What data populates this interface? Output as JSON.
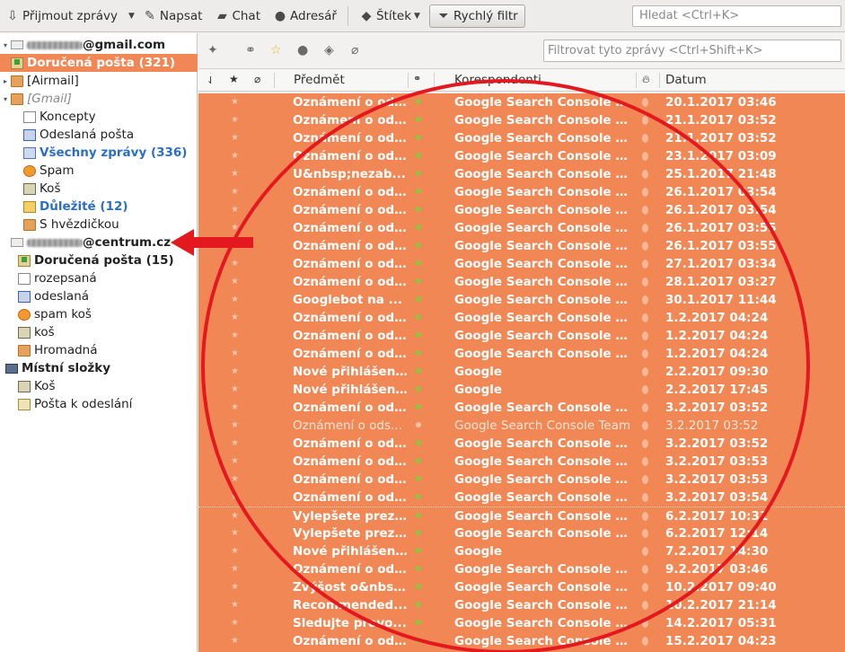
{
  "toolbar": {
    "get_messages": "Přijmout zprávy",
    "write": "Napsat",
    "chat": "Chat",
    "address_book": "Adresář",
    "tag": "Štítek",
    "quick_filter": "Rychlý filtr",
    "search_placeholder": "Hledat <Ctrl+K>"
  },
  "folders": {
    "gmail_account": "@gmail.com",
    "gmail_inbox": "Doručená pošta (321)",
    "airmail": "[Airmail]",
    "gmail_group": "[Gmail]",
    "drafts": "Koncepty",
    "sent": "Odeslaná pošta",
    "all_mail": "Všechny zprávy (336)",
    "spam": "Spam",
    "trash": "Koš",
    "important": "Důležité (12)",
    "starred": "S hvězdičkou",
    "centrum_account": "@centrum.cz",
    "centrum_inbox": "Doručená pošta (15)",
    "centrum_drafts": "rozepsaná",
    "centrum_sent": "odeslaná",
    "centrum_spam": "spam koš",
    "centrum_trash": "koš",
    "centrum_bulk": "Hromadná",
    "local_folders": "Místní složky",
    "local_trash": "Koš",
    "local_outbox": "Pošta k odeslání"
  },
  "filter_bar": {
    "placeholder": "Filtrovat tyto zprávy <Ctrl+Shift+K>"
  },
  "columns": {
    "subject": "Předmět",
    "correspondents": "Korespondenti",
    "date": "Datum"
  },
  "messages": [
    {
      "subject": "Oznámení o od...",
      "correspondent": "Google Search Console T...",
      "date": "20.1.2017 03:46"
    },
    {
      "subject": "Oznámení o od...",
      "correspondent": "Google Search Console T...",
      "date": "21.1.2017 03:52"
    },
    {
      "subject": "Oznámení o od...",
      "correspondent": "Google Search Console T...",
      "date": "21.1.2017 03:52"
    },
    {
      "subject": "Oznámení o od...",
      "correspondent": "Google Search Console T...",
      "date": "23.1.2017 03:09"
    },
    {
      "subject": "U&nbsp;nezab...",
      "correspondent": "Google Search Console T...",
      "date": "25.1.2017 21:48"
    },
    {
      "subject": "Oznámení o od...",
      "correspondent": "Google Search Console T...",
      "date": "26.1.2017 03:54"
    },
    {
      "subject": "Oznámení o od...",
      "correspondent": "Google Search Console T...",
      "date": "26.1.2017 03:54"
    },
    {
      "subject": "Oznámení o od...",
      "correspondent": "Google Search Console T...",
      "date": "26.1.2017 03:55"
    },
    {
      "subject": "Oznámení o od...",
      "correspondent": "Google Search Console T...",
      "date": "26.1.2017 03:55"
    },
    {
      "subject": "Oznámení o od...",
      "correspondent": "Google Search Console T...",
      "date": "27.1.2017 03:34"
    },
    {
      "subject": "Oznámení o od...",
      "correspondent": "Google Search Console T...",
      "date": "28.1.2017 03:27"
    },
    {
      "subject": "Googlebot na ...",
      "correspondent": "Google Search Console T...",
      "date": "30.1.2017 11:44"
    },
    {
      "subject": "Oznámení o od...",
      "correspondent": "Google Search Console T...",
      "date": "1.2.2017 04:24"
    },
    {
      "subject": "Oznámení o od...",
      "correspondent": "Google Search Console T...",
      "date": "1.2.2017 04:24"
    },
    {
      "subject": "Oznámení o od...",
      "correspondent": "Google Search Console T...",
      "date": "1.2.2017 04:24"
    },
    {
      "subject": "Nové přihlášen...",
      "correspondent": "Google",
      "date": "2.2.2017 09:30"
    },
    {
      "subject": "Nové přihlášen...",
      "correspondent": "Google",
      "date": "2.2.2017 17:45"
    },
    {
      "subject": "Oznámení o od...",
      "correspondent": "Google Search Console T...",
      "date": "3.2.2017 03:52"
    },
    {
      "subject": "Oznámení o ods...",
      "correspondent": "Google Search Console Team",
      "date": "3.2.2017 03:52",
      "read": true
    },
    {
      "subject": "Oznámení o od...",
      "correspondent": "Google Search Console T...",
      "date": "3.2.2017 03:52"
    },
    {
      "subject": "Oznámení o od...",
      "correspondent": "Google Search Console T...",
      "date": "3.2.2017 03:53"
    },
    {
      "subject": "Oznámení o od...",
      "correspondent": "Google Search Console T...",
      "date": "3.2.2017 03:53"
    },
    {
      "subject": "Oznámení o od...",
      "correspondent": "Google Search Console T...",
      "date": "3.2.2017 03:54"
    },
    {
      "subject": "Vylepšete prez...",
      "correspondent": "Google Search Console T...",
      "date": "6.2.2017 10:31"
    },
    {
      "subject": "Vylepšete prez...",
      "correspondent": "Google Search Console T...",
      "date": "6.2.2017 12:14"
    },
    {
      "subject": "Nové přihlášen...",
      "correspondent": "Google",
      "date": "7.2.2017 14:30"
    },
    {
      "subject": "Oznámení o od...",
      "correspondent": "Google Search Console T...",
      "date": "9.2.2017 03:46"
    },
    {
      "subject": "Zvýšost o&nbsp;...",
      "correspondent": "Google Search Console T...",
      "date": "10.2.2017 09:40"
    },
    {
      "subject": "Recommended...",
      "correspondent": "Google Search Console T...",
      "date": "10.2.2017 21:14"
    },
    {
      "subject": "Sledujte provo...",
      "correspondent": "Google Search Console T...",
      "date": "14.2.2017 05:31"
    },
    {
      "subject": "Oznámení o od...",
      "correspondent": "Google Search Console T...",
      "date": "15.2.2017 04:23"
    }
  ],
  "colors": {
    "highlight": "#f08754",
    "annotation_red": "#e3191f"
  }
}
